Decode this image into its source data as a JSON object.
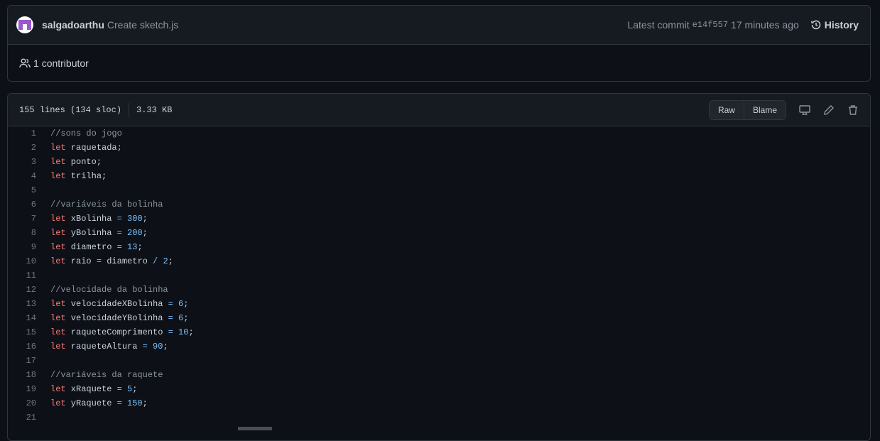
{
  "commit": {
    "author": "salgadoarthu",
    "message": "Create sketch.js",
    "latest_label": "Latest commit",
    "sha": "e14f557",
    "time": "17 minutes ago",
    "history": "History"
  },
  "contributors": {
    "count": "1",
    "label": "contributor"
  },
  "file": {
    "lines": "155 lines (134 sloc)",
    "size": "3.33 KB",
    "raw": "Raw",
    "blame": "Blame"
  },
  "colors": {
    "keyword": "#ff7b72",
    "number": "#79c0ff",
    "comment": "#8b949e"
  },
  "code": [
    {
      "n": "1",
      "t": [
        [
          "c",
          "//sons do jogo"
        ]
      ]
    },
    {
      "n": "2",
      "t": [
        [
          "k",
          "let"
        ],
        [
          "p",
          " raquetada;"
        ]
      ]
    },
    {
      "n": "3",
      "t": [
        [
          "k",
          "let"
        ],
        [
          "p",
          " ponto;"
        ]
      ]
    },
    {
      "n": "4",
      "t": [
        [
          "k",
          "let"
        ],
        [
          "p",
          " trilha;"
        ]
      ]
    },
    {
      "n": "5",
      "t": []
    },
    {
      "n": "6",
      "t": [
        [
          "c",
          "//variáveis da bolinha"
        ]
      ]
    },
    {
      "n": "7",
      "t": [
        [
          "k",
          "let"
        ],
        [
          "p",
          " xBolinha "
        ],
        [
          "o",
          "="
        ],
        [
          "p",
          " "
        ],
        [
          "n",
          "300"
        ],
        [
          "p",
          ";"
        ]
      ]
    },
    {
      "n": "8",
      "t": [
        [
          "k",
          "let"
        ],
        [
          "p",
          " yBolinha "
        ],
        [
          "o",
          "="
        ],
        [
          "p",
          " "
        ],
        [
          "n",
          "200"
        ],
        [
          "p",
          ";"
        ]
      ]
    },
    {
      "n": "9",
      "t": [
        [
          "k",
          "let"
        ],
        [
          "p",
          " diametro "
        ],
        [
          "o",
          "="
        ],
        [
          "p",
          " "
        ],
        [
          "n",
          "13"
        ],
        [
          "p",
          ";"
        ]
      ]
    },
    {
      "n": "10",
      "t": [
        [
          "k",
          "let"
        ],
        [
          "p",
          " raio "
        ],
        [
          "o",
          "="
        ],
        [
          "p",
          " diametro "
        ],
        [
          "o",
          "/"
        ],
        [
          "p",
          " "
        ],
        [
          "n",
          "2"
        ],
        [
          "p",
          ";"
        ]
      ]
    },
    {
      "n": "11",
      "t": []
    },
    {
      "n": "12",
      "t": [
        [
          "c",
          "//velocidade da bolinha"
        ]
      ]
    },
    {
      "n": "13",
      "t": [
        [
          "k",
          "let"
        ],
        [
          "p",
          " velocidadeXBolinha "
        ],
        [
          "o",
          "="
        ],
        [
          "p",
          " "
        ],
        [
          "n",
          "6"
        ],
        [
          "p",
          ";"
        ]
      ]
    },
    {
      "n": "14",
      "t": [
        [
          "k",
          "let"
        ],
        [
          "p",
          " velocidadeYBolinha "
        ],
        [
          "o",
          "="
        ],
        [
          "p",
          " "
        ],
        [
          "n",
          "6"
        ],
        [
          "p",
          ";"
        ]
      ]
    },
    {
      "n": "15",
      "t": [
        [
          "k",
          "let"
        ],
        [
          "p",
          " raqueteComprimento "
        ],
        [
          "o",
          "="
        ],
        [
          "p",
          " "
        ],
        [
          "n",
          "10"
        ],
        [
          "p",
          ";"
        ]
      ]
    },
    {
      "n": "16",
      "t": [
        [
          "k",
          "let"
        ],
        [
          "p",
          " raqueteAltura "
        ],
        [
          "o",
          "="
        ],
        [
          "p",
          " "
        ],
        [
          "n",
          "90"
        ],
        [
          "p",
          ";"
        ]
      ]
    },
    {
      "n": "17",
      "t": []
    },
    {
      "n": "18",
      "t": [
        [
          "c",
          "//variáveis da raquete"
        ]
      ]
    },
    {
      "n": "19",
      "t": [
        [
          "k",
          "let"
        ],
        [
          "p",
          " xRaquete "
        ],
        [
          "o",
          "="
        ],
        [
          "p",
          " "
        ],
        [
          "n",
          "5"
        ],
        [
          "p",
          ";"
        ]
      ]
    },
    {
      "n": "20",
      "t": [
        [
          "k",
          "let"
        ],
        [
          "p",
          " yRaquete "
        ],
        [
          "o",
          "="
        ],
        [
          "p",
          " "
        ],
        [
          "n",
          "150"
        ],
        [
          "p",
          ";"
        ]
      ]
    },
    {
      "n": "21",
      "t": []
    }
  ]
}
